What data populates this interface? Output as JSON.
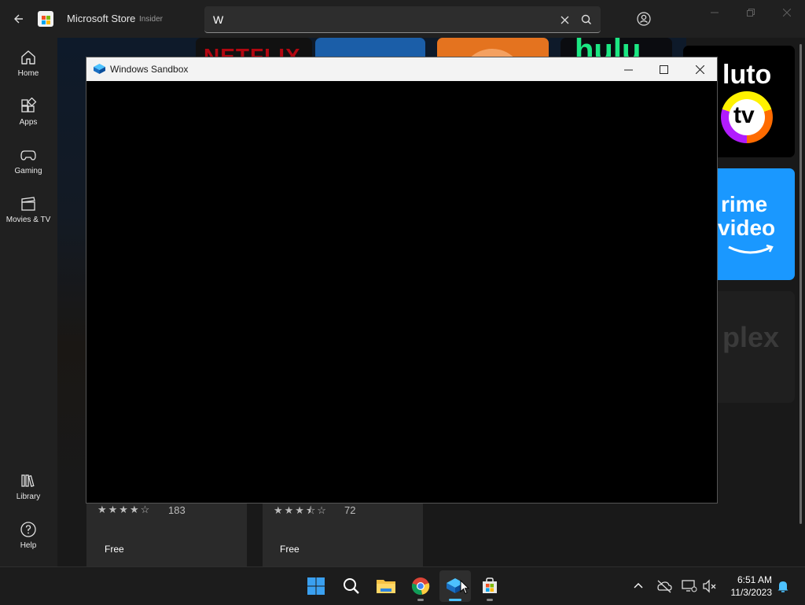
{
  "store": {
    "title": "Microsoft Store",
    "channel": "Insider",
    "search_value": "W"
  },
  "nav": {
    "items": [
      {
        "label": "Home",
        "icon": "home-icon"
      },
      {
        "label": "Apps",
        "icon": "apps-icon"
      },
      {
        "label": "Gaming",
        "icon": "gamepad-icon"
      },
      {
        "label": "Movies & TV",
        "icon": "clapperboard-icon"
      },
      {
        "label": "Library",
        "icon": "library-icon"
      },
      {
        "label": "Help",
        "icon": "help-icon"
      }
    ]
  },
  "hero_tiles": {
    "netflix": "NETFLIX",
    "hulu": "hulu",
    "pluto_line1": "luto",
    "pluto_line2": "tv",
    "prime_line1": "rime",
    "prime_line2": "video",
    "plex": "plex"
  },
  "cards": [
    {
      "rating_stars": 4.5,
      "rating_count": "183",
      "price": "Free"
    },
    {
      "rating_stars": 3.5,
      "rating_count": "72",
      "price": "Free"
    }
  ],
  "sandbox": {
    "title": "Windows Sandbox"
  },
  "taskbar": {
    "apps": [
      "start-icon",
      "search-icon",
      "file-explorer-icon",
      "chrome-icon",
      "windows-sandbox-icon",
      "microsoft-store-icon"
    ],
    "time": "6:51 AM",
    "date": "11/3/2023"
  },
  "colors": {
    "accent": "#4cc2ff",
    "store_bg": "#202020",
    "taskbar_bg": "#1c1c1c"
  }
}
